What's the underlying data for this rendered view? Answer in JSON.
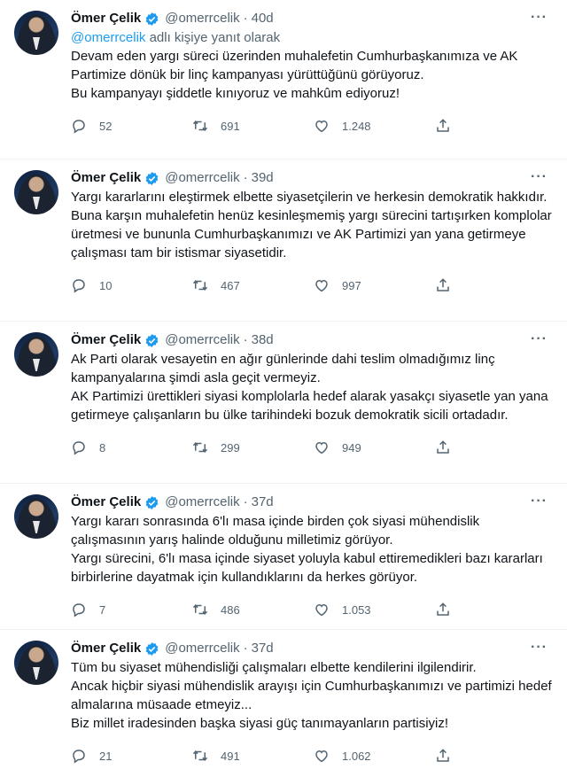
{
  "tweets": [
    {
      "name": "Ömer Çelik",
      "handle": "@omerrcelik",
      "time": "40d",
      "reply_mention": "@omerrcelik",
      "reply_suffix": " adlı kişiye yanıt olarak",
      "lines": [
        "Devam eden yargı süreci üzerinden muhalefetin Cumhurbaşkanımıza ve AK Partimize dönük bir linç kampanyası yürüttüğünü görüyoruz.",
        "Bu kampanyayı şiddetle kınıyoruz ve mahkûm ediyoruz!"
      ],
      "replies": "52",
      "retweets": "691",
      "likes": "1.248"
    },
    {
      "name": "Ömer Çelik",
      "handle": "@omerrcelik",
      "time": "39d",
      "lines": [
        "Yargı kararlarını eleştirmek elbette siyasetçilerin ve herkesin demokratik hakkıdır.",
        "Buna karşın muhalefetin henüz kesinleşmemiş yargı sürecini tartışırken komplolar üretmesi ve bununla Cumhurbaşkanımızı ve AK Partimizi yan yana getirmeye çalışması tam bir istismar siyasetidir."
      ],
      "replies": "10",
      "retweets": "467",
      "likes": "997"
    },
    {
      "name": "Ömer Çelik",
      "handle": "@omerrcelik",
      "time": "38d",
      "lines": [
        "Ak Parti olarak vesayetin en ağır günlerinde dahi teslim olmadığımız linç kampanyalarına şimdi asla geçit vermeyiz.",
        "AK Partimizi ürettikleri siyasi komplolarla hedef alarak yasakçı siyasetle yan yana getirmeye çalışanların bu ülke tarihindeki bozuk demokratik sicili ortadadır."
      ],
      "replies": "8",
      "retweets": "299",
      "likes": "949"
    },
    {
      "name": "Ömer Çelik",
      "handle": "@omerrcelik",
      "time": "37d",
      "lines": [
        "Yargı kararı sonrasında 6'lı masa içinde birden çok siyasi mühendislik çalışmasının yarış halinde olduğunu milletimiz görüyor.",
        "Yargı sürecini, 6'lı masa içinde siyaset yoluyla kabul ettiremedikleri bazı kararları birbirlerine dayatmak için kullandıklarını da herkes görüyor."
      ],
      "replies": "7",
      "retweets": "486",
      "likes": "1.053"
    },
    {
      "name": "Ömer Çelik",
      "handle": "@omerrcelik",
      "time": "37d",
      "lines": [
        "Tüm bu siyaset mühendisliği çalışmaları elbette kendilerini ilgilendirir.",
        "Ancak hiçbir siyasi mühendislik arayışı için Cumhurbaşkanımızı ve partimizi hedef almalarına müsaade etmeyiz...",
        "Biz millet iradesinden başka siyasi güç tanımayanların partisiyiz!"
      ],
      "replies": "21",
      "retweets": "491",
      "likes": "1.062"
    }
  ],
  "colors": {
    "accent": "#1d9bf0",
    "muted": "#536471",
    "text": "#0f1419"
  },
  "icons": [
    "verified-badge-icon",
    "more-icon",
    "reply-icon",
    "retweet-icon",
    "like-icon",
    "share-icon"
  ]
}
